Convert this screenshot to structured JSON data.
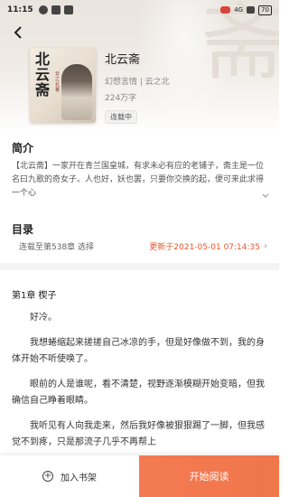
{
  "status_bar": {
    "time": "11:15",
    "network": "4G",
    "battery": "70"
  },
  "book": {
    "title": "北云斋",
    "meta": "幻想言情 | 云之北",
    "words": "224万字",
    "status": "连载中",
    "cover": {
      "title": "北云斋",
      "author": "云之北著"
    }
  },
  "intro": {
    "heading": "简介",
    "text": "【北云斋】一家开在青兰国皇城，有求未必有应的老铺子，斋主是一位名曰九歌的奇女子。人也好，妖也罢，只要你交换的起，便可来此求得一个心"
  },
  "toc": {
    "heading": "目录",
    "latest": "连载至第538章 选择",
    "updated": "更新于2021-05-01 07:14:35",
    "chevron": "›"
  },
  "chapter": {
    "title": "第1章 楔子",
    "paragraphs": [
      "好冷。",
      "我想蜷缩起来搓搓自己冰凉的手，但是好像做不到，我的身体开始不听使唤了。",
      "眼前的人是谁呢，看不清楚，视野逐渐模糊开始变暗，但我确信自己睁着眼睛。",
      "我听见有人向我走来，然后我好像被狠狠踢了一脚，但我感觉不到疼，只是那流子几乎不再帮上"
    ]
  },
  "bottom": {
    "shelf_label": "加入书架",
    "read_label": "开始阅读"
  },
  "colors": {
    "accent": "#f0764b",
    "update_text": "#e8562d"
  }
}
